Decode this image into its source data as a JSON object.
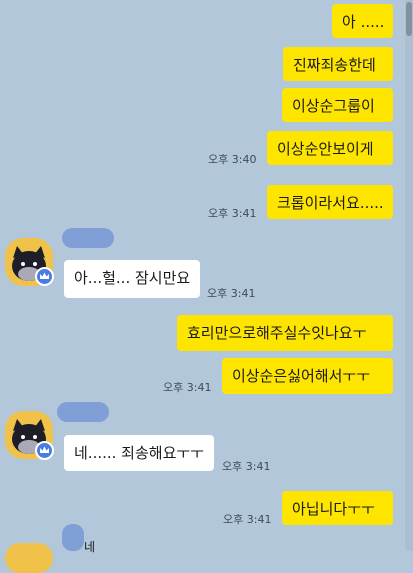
{
  "messages": {
    "m1": "아  .....",
    "m2": "진짜죄송한데",
    "m3": "이상순그룹이",
    "m4": "이상순안보이게",
    "m5": "크롭이라서요.....",
    "r1": "아...헐... 잠시만요",
    "m6": "효리만으로해주실수잇나요ㅜ",
    "m7": "이상순은싫어해서ㅜㅜ",
    "r2": "네...... 죄송해요ㅜㅜ",
    "m8": "아닙니다ㅜㅜ",
    "r3_partial": "네"
  },
  "times": {
    "t1": "오후 3:40",
    "t2": "오후 3:41",
    "t3": "오후 3:41",
    "t4": "오후 3:41",
    "t5": "오후 3:41",
    "t6": "오후 3:41"
  },
  "colors": {
    "background": "#b2c7da",
    "my_bubble": "#fee500",
    "their_bubble": "#ffffff",
    "redaction": "#7f9fd6"
  },
  "icons": {
    "avatar": "cat-face-avatar",
    "badge": "crown-badge-icon"
  }
}
